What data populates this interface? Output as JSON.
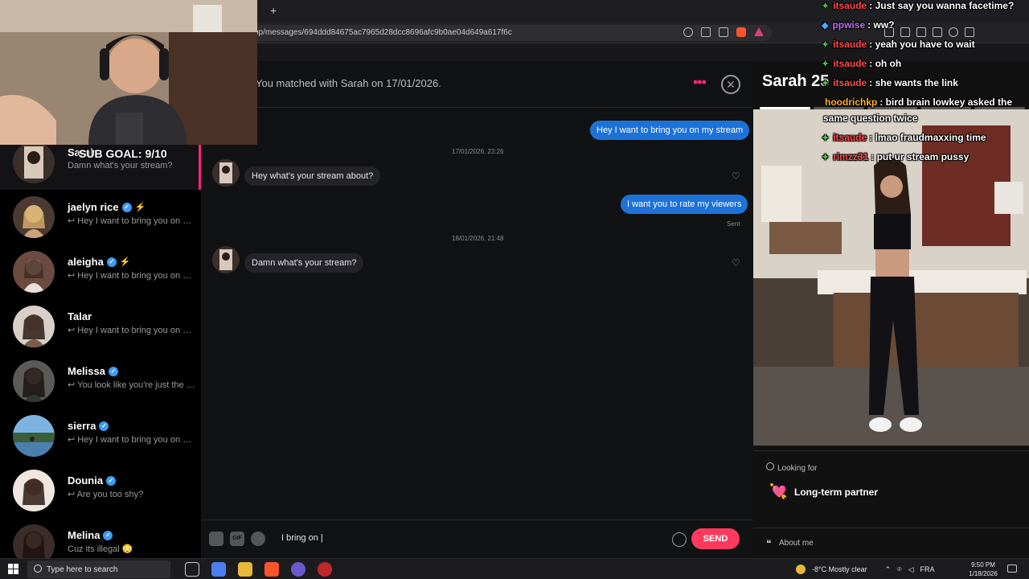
{
  "browser": {
    "new_tab_label": "+",
    "url": "op/messages/694ddd84675ac7965d28dcc8696afc9b0ae04d649a617f6c"
  },
  "conversations": [
    {
      "name": "Sarah",
      "preview": "Damn what's your stream?",
      "verified": false,
      "active": true
    },
    {
      "name": "jaelyn rice",
      "preview": "↩ Hey I want to bring you on my stream",
      "verified": true,
      "bolt": true
    },
    {
      "name": "aleigha",
      "preview": "↩ Hey I want to bring you on my stream",
      "verified": true,
      "bolt": true
    },
    {
      "name": "Talar",
      "preview": "↩ Hey I want to bring you on my stream",
      "verified": false
    },
    {
      "name": "Melissa",
      "preview": "↩ You look like you're just the type",
      "verified": true
    },
    {
      "name": "sierra",
      "preview": "↩ Hey I want to bring you on my stream",
      "verified": true
    },
    {
      "name": "Dounia",
      "preview": "↩ Are you too shy?",
      "verified": true
    },
    {
      "name": "Melina",
      "preview": "Cuz its illegal 😳",
      "verified": true
    }
  ],
  "chat": {
    "header_title": "You matched with Sarah on 17/01/2026.",
    "menu_icon": "more-dots-icon",
    "close_glyph": "✕",
    "messages": [
      {
        "from": "me",
        "text": "Hey I want to bring you on my stream"
      },
      {
        "stamp": "17/01/2026, 23:26"
      },
      {
        "from": "them",
        "text": "Hey what's your stream about?"
      },
      {
        "from": "me",
        "text": "I want you to rate my viewers",
        "status": "Sent"
      },
      {
        "stamp": "18/01/2026, 21:48"
      },
      {
        "from": "them",
        "text": "Damn what's your stream?"
      }
    ],
    "composer": {
      "gif_label": "GIF",
      "value": "I bring on |",
      "send_label": "SEND"
    }
  },
  "profile": {
    "name": "Sarah 25",
    "looking_for_label": "Looking for",
    "looking_for_emoji": "💘",
    "looking_for_value": "Long-term partner",
    "about_label": "About me",
    "about_icon": "❝"
  },
  "overlay": {
    "sub_goal": "SUB GOAL: 9/10",
    "chat": [
      {
        "user": "itsaude",
        "text": ": Just say you wanna facetime?",
        "color": "#ff4d4d"
      },
      {
        "user": "ppwise",
        "text": ": ww?",
        "color": "#c86bff"
      },
      {
        "user": "itsaude",
        "text": ": yeah you have to wait",
        "color": "#ff4d4d"
      },
      {
        "user": "itsaude",
        "text": ": oh oh",
        "color": "#ff4d4d"
      },
      {
        "user": "itsaude",
        "text": ": she wants the link",
        "color": "#ff4d4d"
      },
      {
        "user": "hoodrichkp",
        "text": ": bird brain lowkey asked the",
        "color": "#ffb02e"
      },
      {
        "user": "",
        "text": "same question twice",
        "color": "#ffffff"
      },
      {
        "user": "itsaude",
        "text": ": lmao fraudmaxxing time",
        "color": "#ff4d4d"
      },
      {
        "user": "rimzz31",
        "text": ": put ur stream pussy",
        "color": "#ff4d4d"
      }
    ]
  },
  "taskbar": {
    "search_placeholder": "Type here to search",
    "weather": "-8°C  Mostly clear",
    "language": "FRA",
    "time": "9:50 PM",
    "date": "1/18/2026"
  },
  "colors": {
    "accent": "#fd267d",
    "outgoing_bubble": "#1d72d8",
    "send_button": "#fd3a5e"
  }
}
